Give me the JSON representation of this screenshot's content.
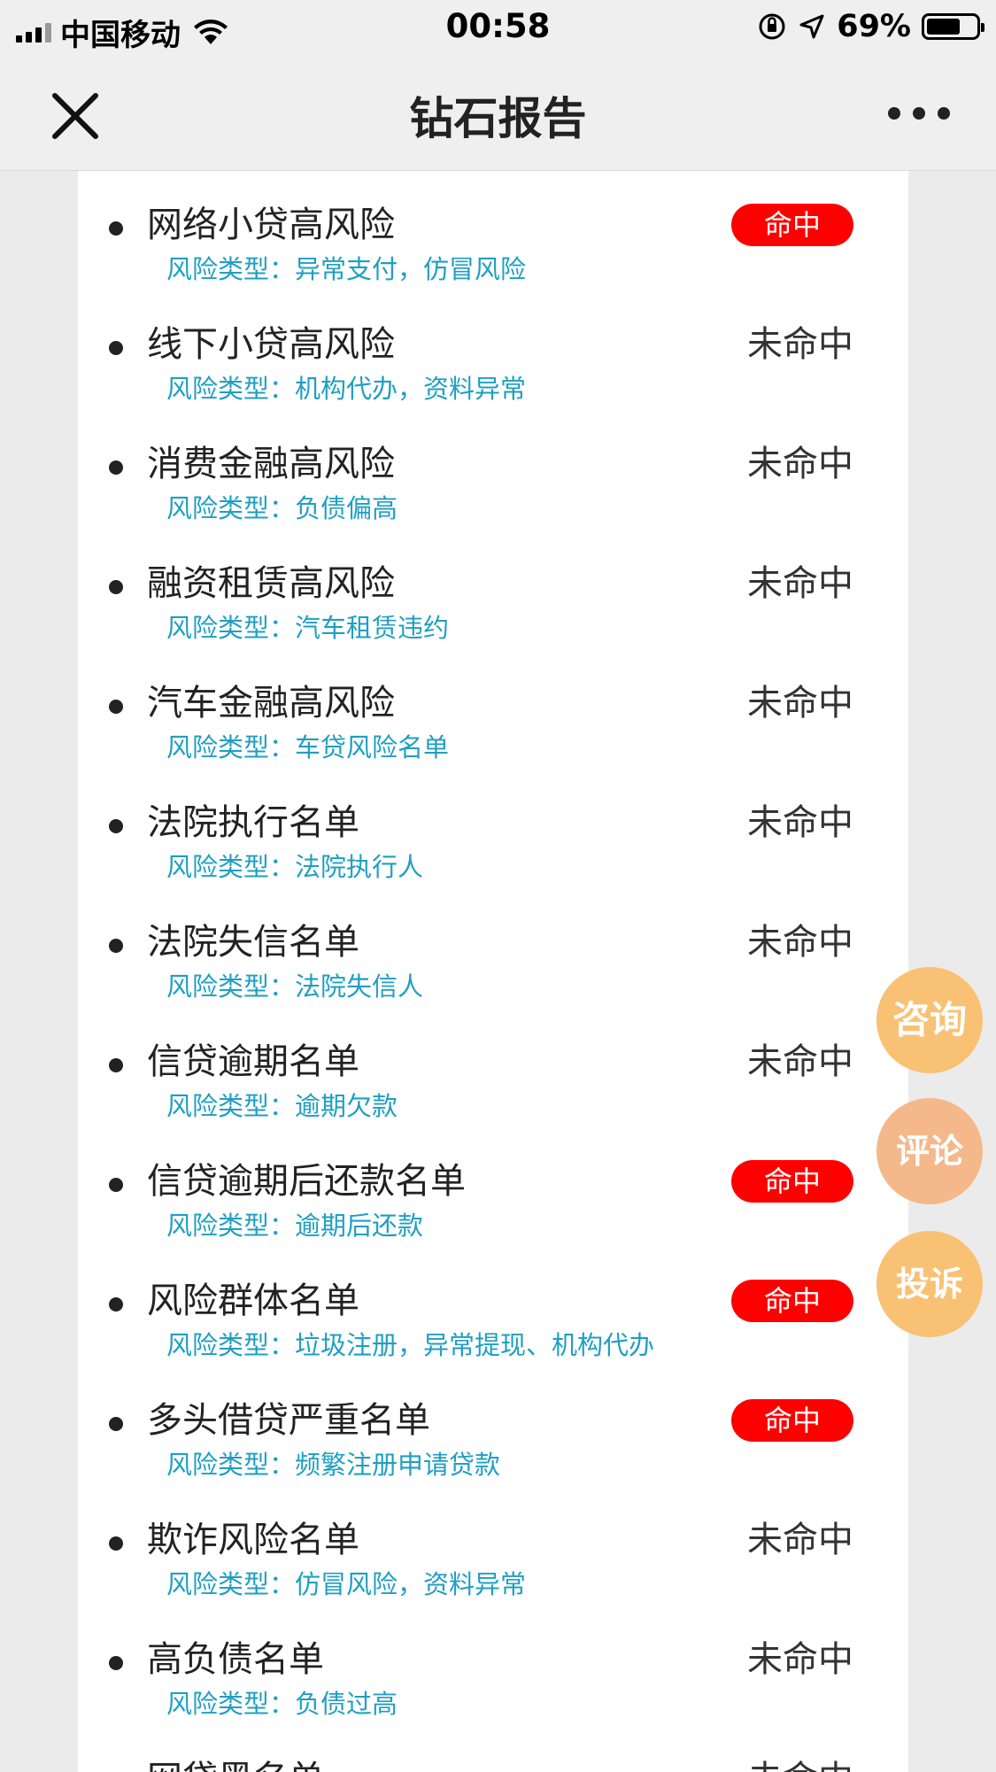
{
  "status_bar": {
    "carrier": "中国移动",
    "time": "00:58",
    "battery_percent": "69%",
    "battery_level": 0.69
  },
  "nav": {
    "title": "钻石报告",
    "close_icon": "close-icon",
    "more_icon": "more-icon"
  },
  "list_items": [
    {
      "title": "",
      "type": "",
      "status": ""
    },
    {
      "title": "网络小贷高风险",
      "type": "风险类型：异常支付，仿冒风险",
      "status": "命中",
      "hit": true
    },
    {
      "title": "线下小贷高风险",
      "type": "风险类型：机构代办，资料异常",
      "status": "未命中",
      "hit": false
    },
    {
      "title": "消费金融高风险",
      "type": "风险类型：负债偏高",
      "status": "未命中",
      "hit": false
    },
    {
      "title": "融资租赁高风险",
      "type": "风险类型：汽车租赁违约",
      "status": "未命中",
      "hit": false
    },
    {
      "title": "汽车金融高风险",
      "type": "风险类型：车贷风险名单",
      "status": "未命中",
      "hit": false
    },
    {
      "title": "法院执行名单",
      "type": "风险类型：法院执行人",
      "status": "未命中",
      "hit": false
    },
    {
      "title": "法院失信名单",
      "type": "风险类型：法院失信人",
      "status": "未命中",
      "hit": false
    },
    {
      "title": "信贷逾期名单",
      "type": "风险类型：逾期欠款",
      "status": "未命中",
      "hit": false
    },
    {
      "title": "信贷逾期后还款名单",
      "type": "风险类型：逾期后还款",
      "status": "命中",
      "hit": true
    },
    {
      "title": "风险群体名单",
      "type": "风险类型：垃圾注册，异常提现、机构代办",
      "status": "命中",
      "hit": true
    },
    {
      "title": "多头借贷严重名单",
      "type": "风险类型：频繁注册申请贷款",
      "status": "命中",
      "hit": true
    },
    {
      "title": "欺诈风险名单",
      "type": "风险类型：仿冒风险，资料异常",
      "status": "未命中",
      "hit": false
    },
    {
      "title": "高负债名单",
      "type": "风险类型：负债过高",
      "status": "未命中",
      "hit": false
    },
    {
      "title": "网贷黑名单",
      "type": "",
      "status": "未命中",
      "hit": false
    }
  ],
  "floating_buttons": {
    "consult": "咨询",
    "comment": "评论",
    "complain": "投诉"
  }
}
